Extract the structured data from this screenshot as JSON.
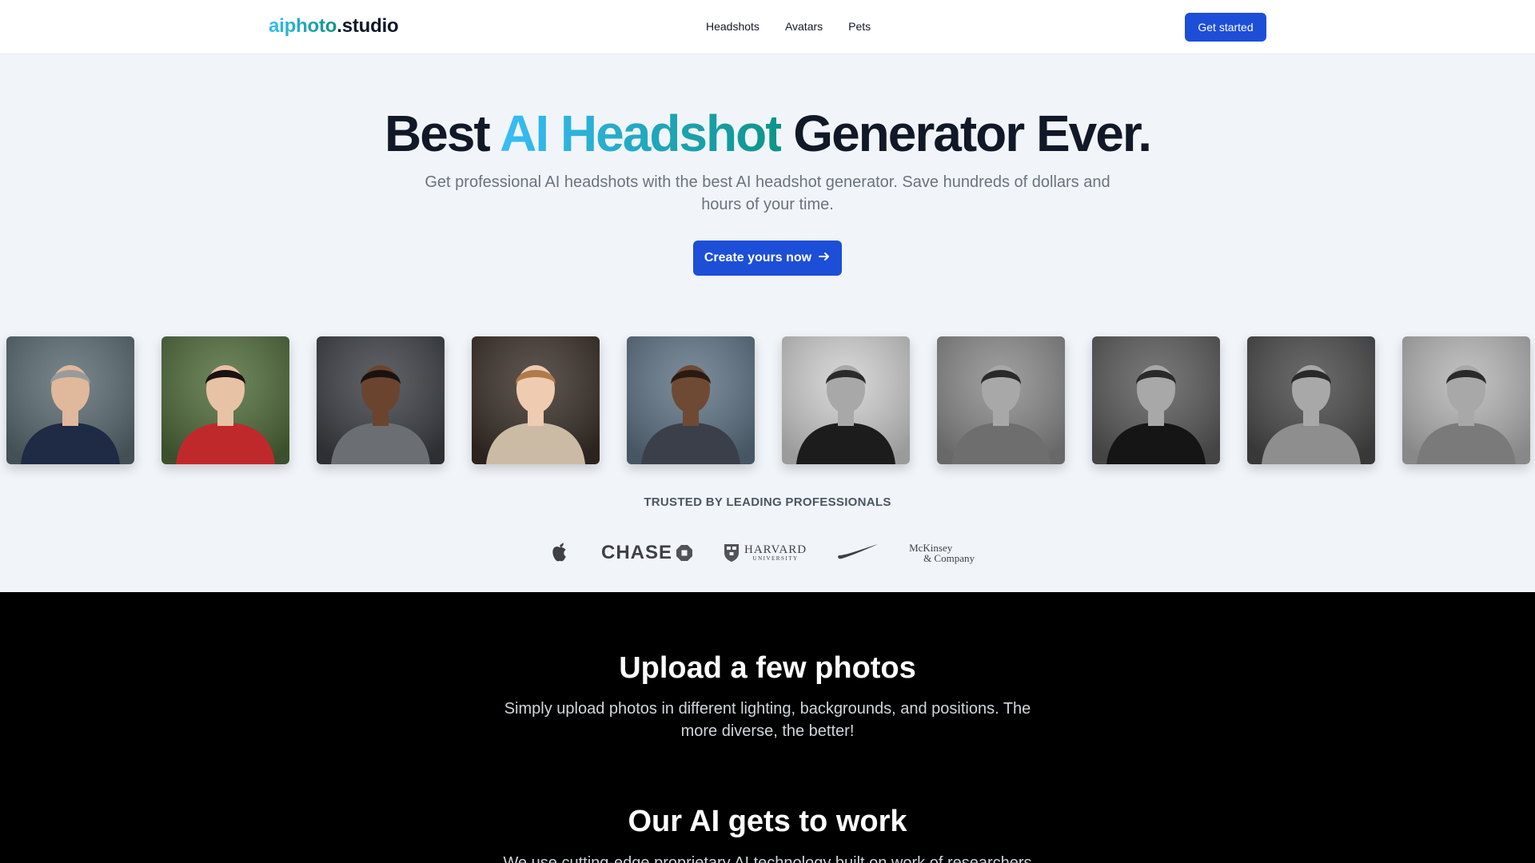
{
  "brand": {
    "logo_part1": "aiphoto",
    "logo_part2": ".studio",
    "accent_gradient": [
      "#38bdf8",
      "#0d9488"
    ],
    "primary_color": "#1d4ed8"
  },
  "nav": {
    "links": [
      "Headshots",
      "Avatars",
      "Pets"
    ],
    "cta_label": "Get started"
  },
  "hero": {
    "title_prefix": "Best ",
    "title_highlight": "AI Headshot",
    "title_suffix": " Generator Ever.",
    "subtitle": "Get professional AI headshots with the best AI headshot generator. Save hundreds of dollars and hours of your time.",
    "cta_label": "Create yours now",
    "cta_icon": "arrow-right-icon"
  },
  "gallery": {
    "items": [
      {
        "label": "headshot-1",
        "style": "color",
        "bg": "#5a6b72",
        "clothing": "#1f2a44"
      },
      {
        "label": "headshot-2",
        "style": "color",
        "bg": "#4f6b3a",
        "clothing": "#c0292b"
      },
      {
        "label": "headshot-3",
        "style": "color",
        "bg": "#3c3f44",
        "clothing": "#6b6e73"
      },
      {
        "label": "headshot-4",
        "style": "color",
        "bg": "#3a2f28",
        "clothing": "#cbbba4"
      },
      {
        "label": "headshot-5",
        "style": "color",
        "bg": "#5f7385",
        "clothing": "#3b3f4a"
      },
      {
        "label": "headshot-6",
        "style": "mono",
        "bg": "#cfcfcf",
        "clothing": "#1c1c1c"
      },
      {
        "label": "headshot-7",
        "style": "mono",
        "bg": "#8a8a8a",
        "clothing": "#6e6e6e"
      },
      {
        "label": "headshot-8",
        "style": "mono",
        "bg": "#5a5a5a",
        "clothing": "#151515"
      },
      {
        "label": "headshot-9",
        "style": "mono",
        "bg": "#4a4a4a",
        "clothing": "#8e8e8e"
      },
      {
        "label": "headshot-10",
        "style": "mono",
        "bg": "#b5b5b5",
        "clothing": "#7a7a7a"
      }
    ]
  },
  "trusted": {
    "heading": "TRUSTED BY LEADING PROFESSIONALS",
    "logos": [
      "apple-logo",
      "CHASE",
      "HARVARD",
      "UNIVERSITY",
      "nike-logo",
      "McKinsey",
      "& Company"
    ]
  },
  "features": [
    {
      "title": "Upload a few photos",
      "text": "Simply upload photos in different lighting, backgrounds, and positions. The more diverse, the better!"
    },
    {
      "title": "Our AI gets to work",
      "text": "We use cutting-edge proprietary AI technology built on work of researchers"
    }
  ]
}
